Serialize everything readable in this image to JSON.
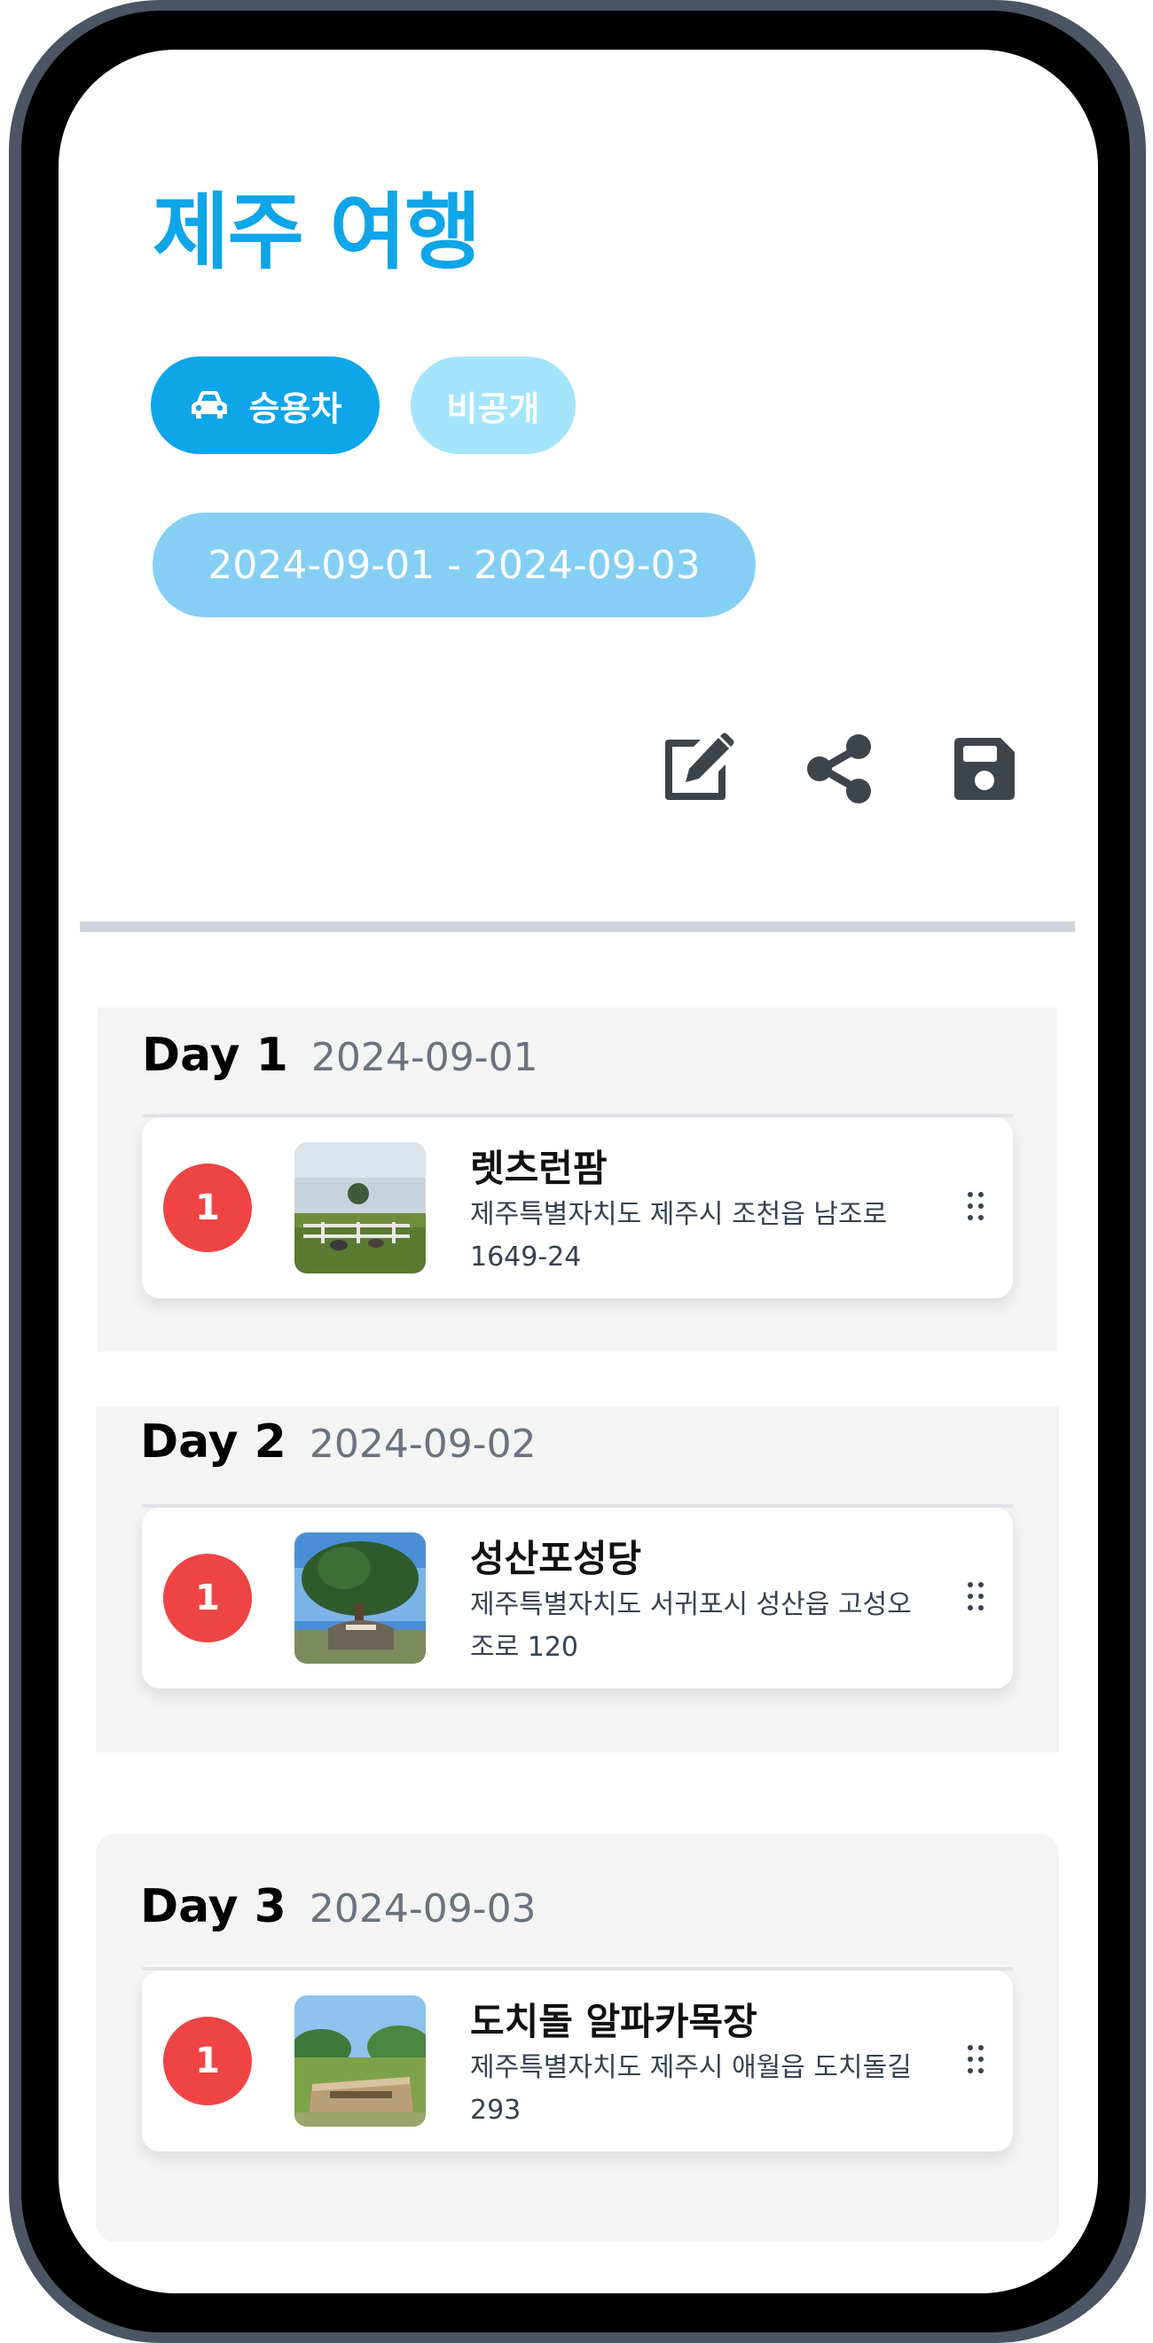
{
  "trip": {
    "title": "제주 여행",
    "vehicle_label": "승용차",
    "visibility_label": "비공개",
    "date_range": "2024-09-01 - 2024-09-03"
  },
  "toolbar": {
    "icons": [
      "edit-icon",
      "share-icon",
      "save-icon"
    ]
  },
  "days": [
    {
      "label": "Day 1",
      "date": "2024-09-01",
      "places": [
        {
          "order": "1",
          "name": "렛츠런팜",
          "address": "제주특별자치도 제주시 조천읍 남조로 1649-24"
        }
      ]
    },
    {
      "label": "Day 2",
      "date": "2024-09-02",
      "places": [
        {
          "order": "1",
          "name": "성산포성당",
          "address": "제주특별자치도 서귀포시 성산읍 고성오조로 120"
        }
      ]
    },
    {
      "label": "Day 3",
      "date": "2024-09-03",
      "places": [
        {
          "order": "1",
          "name": "도치돌 알파카목장",
          "address": "제주특별자치도 제주시 애월읍 도치돌길 293"
        }
      ]
    }
  ],
  "colors": {
    "accent": "#0ea5e9",
    "accent_light": "#a5e5fb",
    "date_chip": "#85cff5",
    "badge": "#ef4444",
    "day_bg": "#f4f4f4"
  }
}
